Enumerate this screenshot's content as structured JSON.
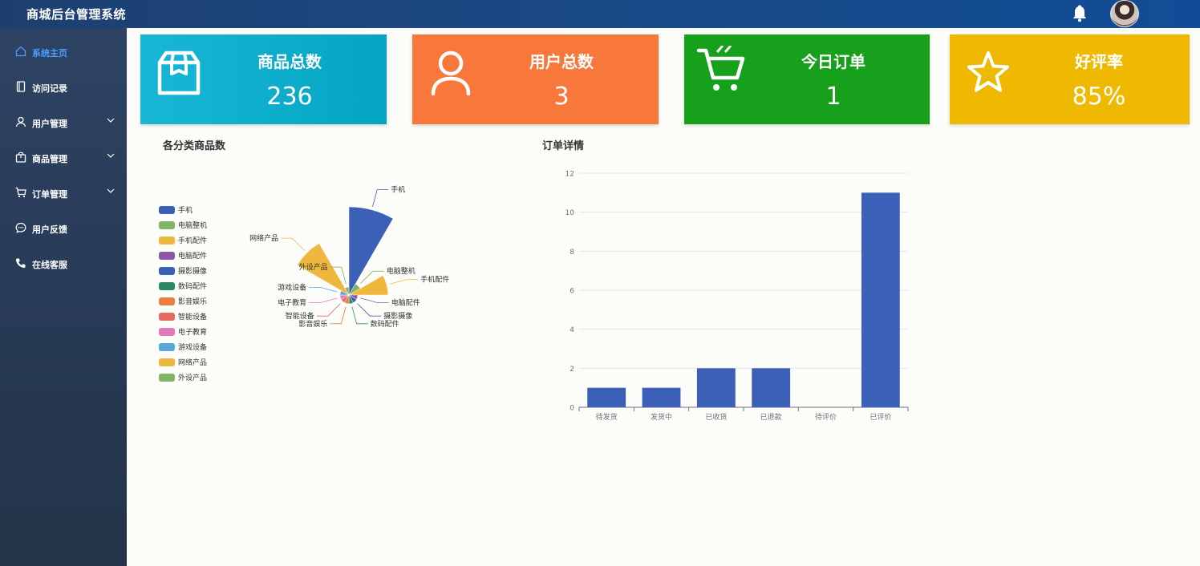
{
  "header": {
    "title": "商城后台管理系统"
  },
  "sidebar": {
    "items": [
      {
        "label": "系统主页",
        "icon": "home-icon",
        "active": true
      },
      {
        "label": "访问记录",
        "icon": "notebook-icon"
      },
      {
        "label": "用户管理",
        "icon": "user-icon",
        "expandable": true
      },
      {
        "label": "商品管理",
        "icon": "bag-icon",
        "expandable": true
      },
      {
        "label": "订单管理",
        "icon": "cart-icon",
        "expandable": true
      },
      {
        "label": "用户反馈",
        "icon": "chat-icon"
      },
      {
        "label": "在线客服",
        "icon": "phone-icon"
      }
    ]
  },
  "cards": [
    {
      "title": "商品总数",
      "value": "236",
      "icon": "box-icon",
      "color": "#0aaecb"
    },
    {
      "title": "用户总数",
      "value": "3",
      "icon": "user-icon",
      "color": "#f7783a"
    },
    {
      "title": "今日订单",
      "value": "1",
      "icon": "cart-icon",
      "color": "#16a01b"
    },
    {
      "title": "好评率",
      "value": "85%",
      "icon": "star-icon",
      "color": "#efb902"
    }
  ],
  "sections": {
    "category_title": "各分类商品数",
    "orders_title": "订单详情"
  },
  "chart_data": [
    {
      "type": "pie",
      "subtype": "rose",
      "title": "各分类商品数",
      "legend_position": "left",
      "slices": [
        {
          "name": "手机",
          "value": 100,
          "color": "#3c5fb8"
        },
        {
          "name": "电脑整机",
          "value": 8,
          "color": "#80b566"
        },
        {
          "name": "手机配件",
          "value": 40,
          "color": "#efb73e"
        },
        {
          "name": "电脑配件",
          "value": 3,
          "color": "#8e56a8"
        },
        {
          "name": "摄影摄像",
          "value": 3,
          "color": "#3c5fb8"
        },
        {
          "name": "数码配件",
          "value": 3,
          "color": "#2c8a63"
        },
        {
          "name": "影音娱乐",
          "value": 3,
          "color": "#f07b3f"
        },
        {
          "name": "智能设备",
          "value": 3,
          "color": "#e86a5f"
        },
        {
          "name": "电子教育",
          "value": 3,
          "color": "#e07ac0"
        },
        {
          "name": "游戏设备",
          "value": 3,
          "color": "#5aa8d6"
        },
        {
          "name": "网络产品",
          "value": 65,
          "color": "#efb73e"
        },
        {
          "name": "外设产品",
          "value": 2,
          "color": "#80b566"
        }
      ]
    },
    {
      "type": "bar",
      "title": "订单详情",
      "categories": [
        "待发货",
        "发货中",
        "已收货",
        "已退款",
        "待评价",
        "已评价"
      ],
      "values": [
        1,
        1,
        2,
        2,
        0,
        11
      ],
      "ylim": [
        0,
        12
      ],
      "yticks": [
        0,
        2,
        4,
        6,
        8,
        10,
        12
      ],
      "grid": true,
      "color": "#3c5fb8"
    }
  ]
}
